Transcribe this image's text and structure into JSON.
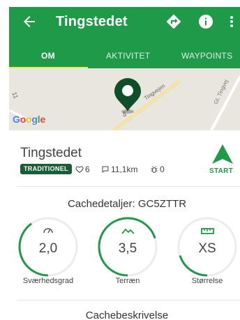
{
  "appbar": {
    "title": "Tingstedet",
    "tabs": [
      {
        "label": "OM",
        "active": true
      },
      {
        "label": "AKTIVITET",
        "active": false
      },
      {
        "label": "WAYPOINTS",
        "active": false
      }
    ],
    "color": "#1f9a49",
    "tab_indicator_color": "#e8ef52",
    "icons": [
      "back-arrow-icon",
      "navigate-icon",
      "info-icon",
      "more-vert-icon"
    ]
  },
  "map": {
    "road_labels": [
      "Tingvejen",
      "Gl. Tingvej"
    ],
    "marker_label": "5",
    "attribution": "Google"
  },
  "cache": {
    "name": "Tingstedet",
    "type_badge": "TRADITIONEL",
    "favorites": "6",
    "distance": "11,1km",
    "logs": "0",
    "start_label": "START"
  },
  "details": {
    "title": "Cachedetaljer: GC5ZTTR",
    "gauges": [
      {
        "value": "2,0",
        "label": "Sværhedsgrad",
        "icon": "difficulty-gauge-icon",
        "fill": 0.4
      },
      {
        "value": "3,5",
        "label": "Terræn",
        "icon": "terrain-mountain-icon",
        "fill": 0.7
      },
      {
        "value": "XS",
        "label": "Størrelse",
        "icon": "size-ruler-icon",
        "fill": 0.2
      }
    ]
  },
  "description": {
    "title": "Cachebeskrivelse"
  }
}
